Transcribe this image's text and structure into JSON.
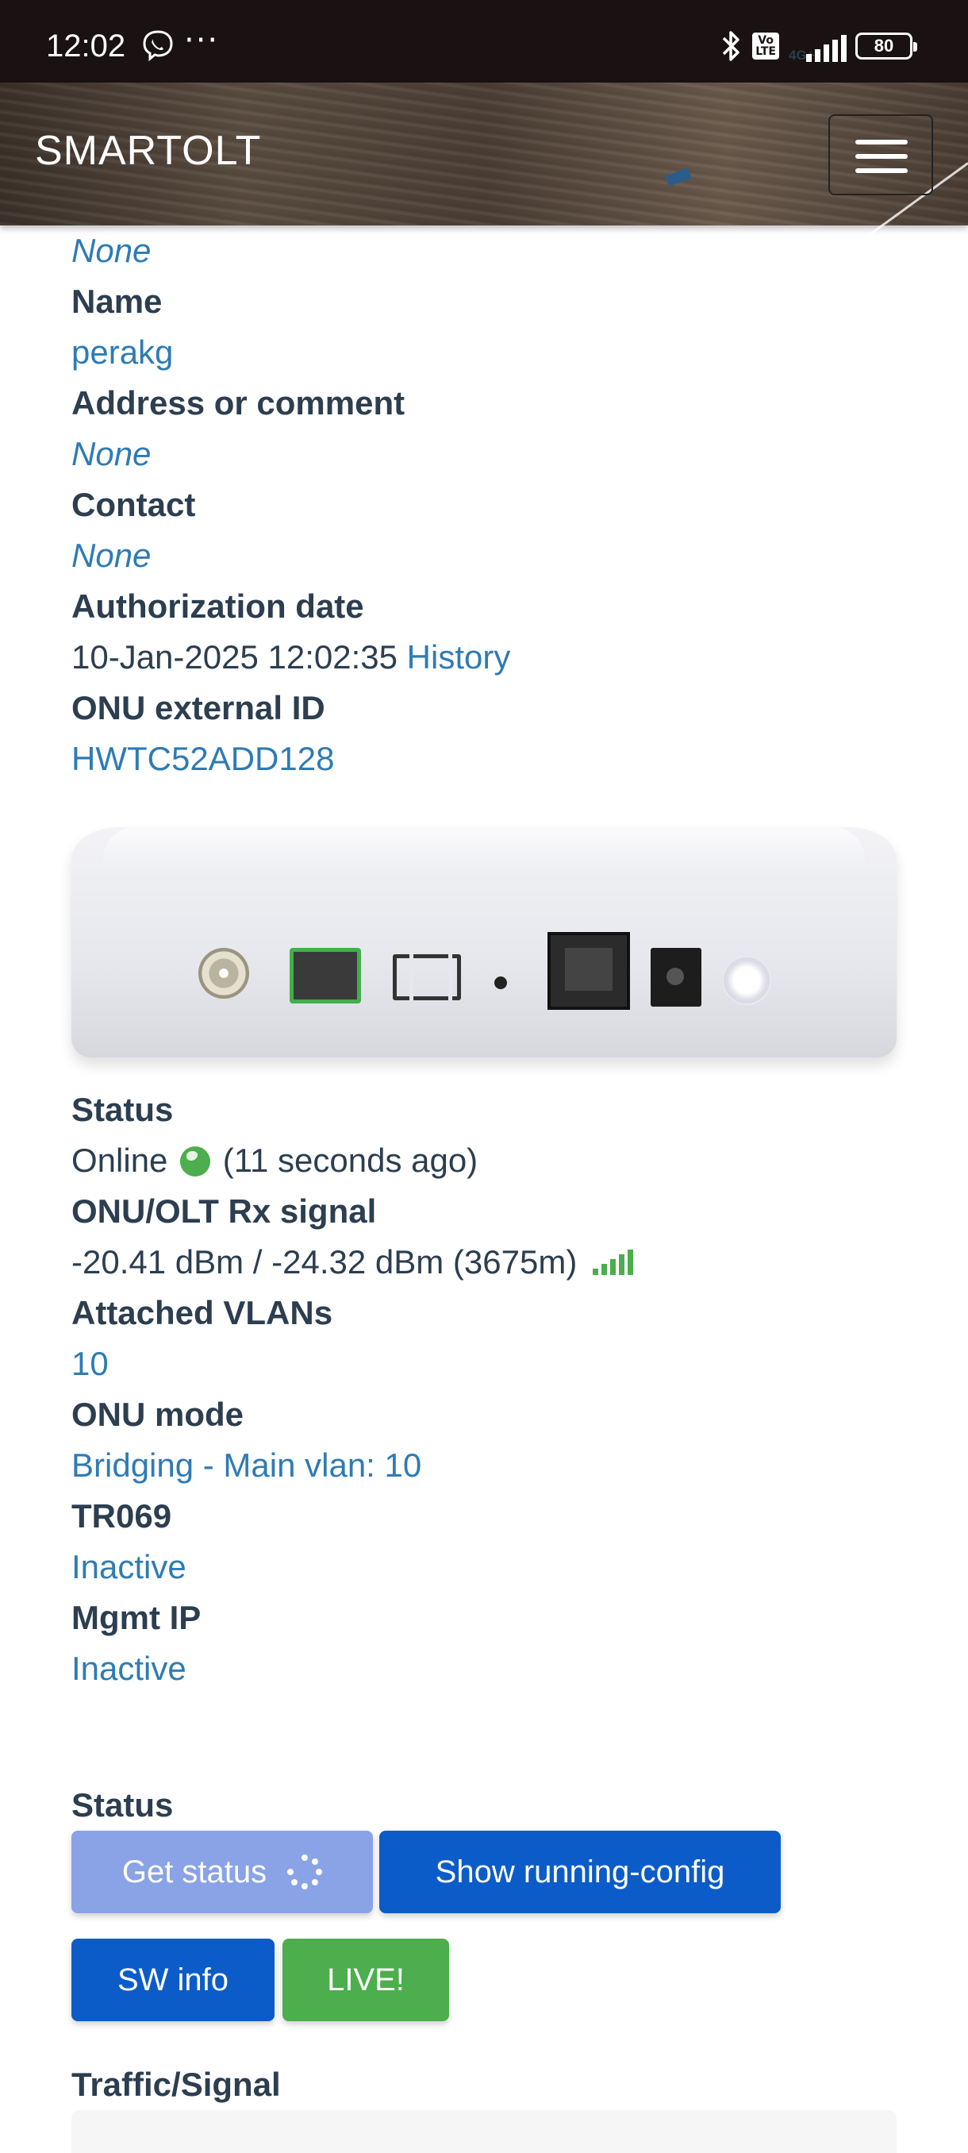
{
  "status_bar": {
    "time": "12:02",
    "volte": "Vo\nLTE",
    "network": "4G+",
    "battery": "80"
  },
  "navbar": {
    "brand": "SMARTOLT"
  },
  "details": {
    "prev_value": "None",
    "name_label": "Name",
    "name_value": "perakg",
    "address_label": "Address or comment",
    "address_value": "None",
    "contact_label": "Contact",
    "contact_value": "None",
    "auth_date_label": "Authorization date",
    "auth_date_value": "10-Jan-2025 12:02:35",
    "auth_history_link": "History",
    "external_id_label": "ONU external ID",
    "external_id_value": "HWTC52ADD128"
  },
  "status_info": {
    "status_label": "Status",
    "status_value": "Online",
    "status_ago": "(11 seconds ago)",
    "rx_label": "ONU/OLT Rx signal",
    "rx_value": "-20.41 dBm / -24.32 dBm (3675m)",
    "vlans_label": "Attached VLANs",
    "vlans_value": "10",
    "mode_label": "ONU mode",
    "mode_value": "Bridging - Main vlan: 10",
    "tr069_label": "TR069",
    "tr069_value": "Inactive",
    "mgmt_label": "Mgmt IP",
    "mgmt_value": "Inactive"
  },
  "actions": {
    "section_label": "Status",
    "get_status": "Get status",
    "show_running_config": "Show running-config",
    "sw_info": "SW info",
    "live": "LIVE!"
  },
  "traffic": {
    "label": "Traffic/Signal"
  },
  "colors": {
    "link": "#2e7bb4",
    "text": "#2c3e50",
    "primary_button": "#0b5cc8",
    "disabled_button": "#8aa3e6",
    "success_button": "#4cae4c"
  }
}
